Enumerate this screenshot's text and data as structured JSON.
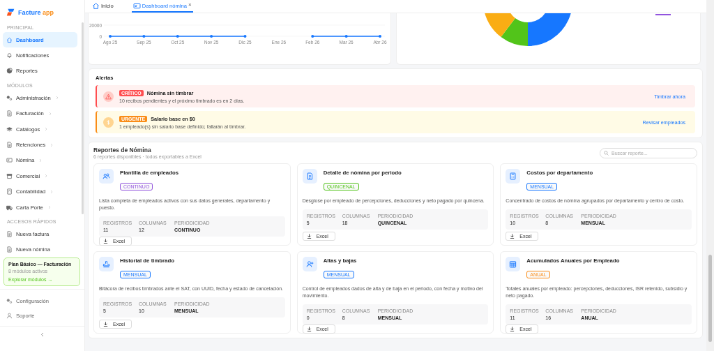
{
  "brand": {
    "name": "Facture",
    "accent": "app"
  },
  "sidebar": {
    "sections": [
      {
        "title": "PRINCIPAL",
        "items": [
          {
            "label": "Dashboard",
            "selected": true,
            "expandable": false
          },
          {
            "label": "Notificaciones",
            "selected": false,
            "expandable": false
          },
          {
            "label": "Reportes",
            "selected": false,
            "expandable": false
          }
        ]
      },
      {
        "title": "MÓDULOS",
        "items": [
          {
            "label": "Administración",
            "selected": false,
            "expandable": true
          },
          {
            "label": "Facturación",
            "selected": false,
            "expandable": true
          },
          {
            "label": "Catálogos",
            "selected": false,
            "expandable": true
          },
          {
            "label": "Retenciones",
            "selected": false,
            "expandable": true
          },
          {
            "label": "Nómina",
            "selected": false,
            "expandable": true
          },
          {
            "label": "Comercial",
            "selected": false,
            "expandable": true
          },
          {
            "label": "Contabilidad",
            "selected": false,
            "expandable": true
          },
          {
            "label": "Carta Porte",
            "selected": false,
            "expandable": true
          }
        ]
      },
      {
        "title": "ACCESOS RÁPIDOS",
        "items": [
          {
            "label": "Nueva factura",
            "selected": false,
            "expandable": false
          },
          {
            "label": "Nueva nómina",
            "selected": false,
            "expandable": false
          }
        ]
      }
    ],
    "plan": {
      "title": "Plan Básico — Facturación",
      "subtitle": "8 módulos activos",
      "link": "Explorar módulos →"
    },
    "footer": [
      {
        "label": "Configuración",
        "selected": false
      },
      {
        "label": "Soporte",
        "selected": false
      }
    ]
  },
  "tabs": [
    {
      "label": "Inicio",
      "selected": false,
      "closable": false
    },
    {
      "label": "Dashboard nómina",
      "selected": true,
      "closable": true,
      "close_mark": "×"
    }
  ],
  "trend": {
    "chart_data": {
      "type": "line",
      "categories": [
        "Ago 25",
        "Sep 25",
        "Oct 25",
        "Nov 25",
        "Dic 25",
        "Ene 26",
        "Feb 26",
        "Mar 26",
        "Abr 26"
      ],
      "yticks": [
        0,
        20000
      ],
      "ylim": [
        0,
        20000
      ],
      "series": [
        {
          "color": "#1677ff",
          "values": [
            0,
            0,
            0,
            0,
            0,
            null,
            0,
            0,
            0
          ]
        }
      ]
    }
  },
  "alerts": {
    "title": "Alertas",
    "items": [
      {
        "kind": "critical",
        "badge": "CRÍTICO",
        "title": "Nómina sin timbrar",
        "text": "10 recibos pendientes y el próximo timbrado es en 2 días.",
        "action": "Timbrar ahora"
      },
      {
        "kind": "urgent",
        "badge": "URGENTE",
        "title": "Salario base en $0",
        "text": "1 empleado(s) sin salario base definido; fallarán al timbrar.",
        "action": "Revisar empleados"
      }
    ]
  },
  "reports": {
    "title": "Reportes de Nómina",
    "subtitle": "6 reportes disponibles · todos exportables a Excel",
    "search_placeholder": "Buscar reporte...",
    "cards": [
      {
        "title": "Plantilla de empleados",
        "badge": "CONTINUO",
        "color": "#9254de",
        "description": "Lista completa de empleados activos con sus datos generales, departamento y puesto.",
        "stats": [
          {
            "label": "REGISTROS",
            "value": "11"
          },
          {
            "label": "COLUMNAS",
            "value": "12"
          },
          {
            "label": "PERIODICIDAD",
            "value": "CONTINUO"
          }
        ],
        "button": "Excel"
      },
      {
        "title": "Detalle de nómina por periodo",
        "badge": "QUINCENAL",
        "color": "#52c41a",
        "description": "Desglose por empleado de percepciones, deducciones y neto pagado por quincena.",
        "stats": [
          {
            "label": "REGISTROS",
            "value": "5"
          },
          {
            "label": "COLUMNAS",
            "value": "18"
          },
          {
            "label": "PERIODICIDAD",
            "value": "QUINCENAL"
          }
        ],
        "button": "Excel"
      },
      {
        "title": "Costos por departamento",
        "badge": "MENSUAL",
        "color": "#1677ff",
        "description": "Concentrado de costos de nómina agrupados por departamento y centro de costo.",
        "stats": [
          {
            "label": "REGISTROS",
            "value": "10"
          },
          {
            "label": "COLUMNAS",
            "value": "8"
          },
          {
            "label": "PERIODICIDAD",
            "value": "MENSUAL"
          }
        ],
        "button": "Excel"
      },
      {
        "title": "Historial de timbrado",
        "badge": "MENSUAL",
        "color": "#1677ff",
        "description": "Bitácora de recibos timbrados ante el SAT, con UUID, fecha y estado de cancelación.",
        "stats": [
          {
            "label": "REGISTROS",
            "value": "5"
          },
          {
            "label": "COLUMNAS",
            "value": "10"
          },
          {
            "label": "PERIODICIDAD",
            "value": "MENSUAL"
          }
        ],
        "button": "Excel"
      },
      {
        "title": "Altas y bajas",
        "badge": "MENSUAL",
        "color": "#1677ff",
        "description": "Control de empleados dados de alta y de baja en el periodo, con fecha y motivo del movimiento.",
        "stats": [
          {
            "label": "REGISTROS",
            "value": "0"
          },
          {
            "label": "COLUMNAS",
            "value": "8"
          },
          {
            "label": "PERIODICIDAD",
            "value": "MENSUAL"
          }
        ],
        "button": "Excel"
      },
      {
        "title": "Acumulados Anuales por Empleado",
        "badge": "ANUAL",
        "color": "#fa8c16",
        "description": "Totales anuales por empleado: percepciones, deducciones, ISR retenido, subsidio y neto pagado.",
        "stats": [
          {
            "label": "REGISTROS",
            "value": "11"
          },
          {
            "label": "COLUMNAS",
            "value": "16"
          },
          {
            "label": "PERIODICIDAD",
            "value": "ANUAL"
          }
        ],
        "button": "Excel"
      }
    ]
  }
}
